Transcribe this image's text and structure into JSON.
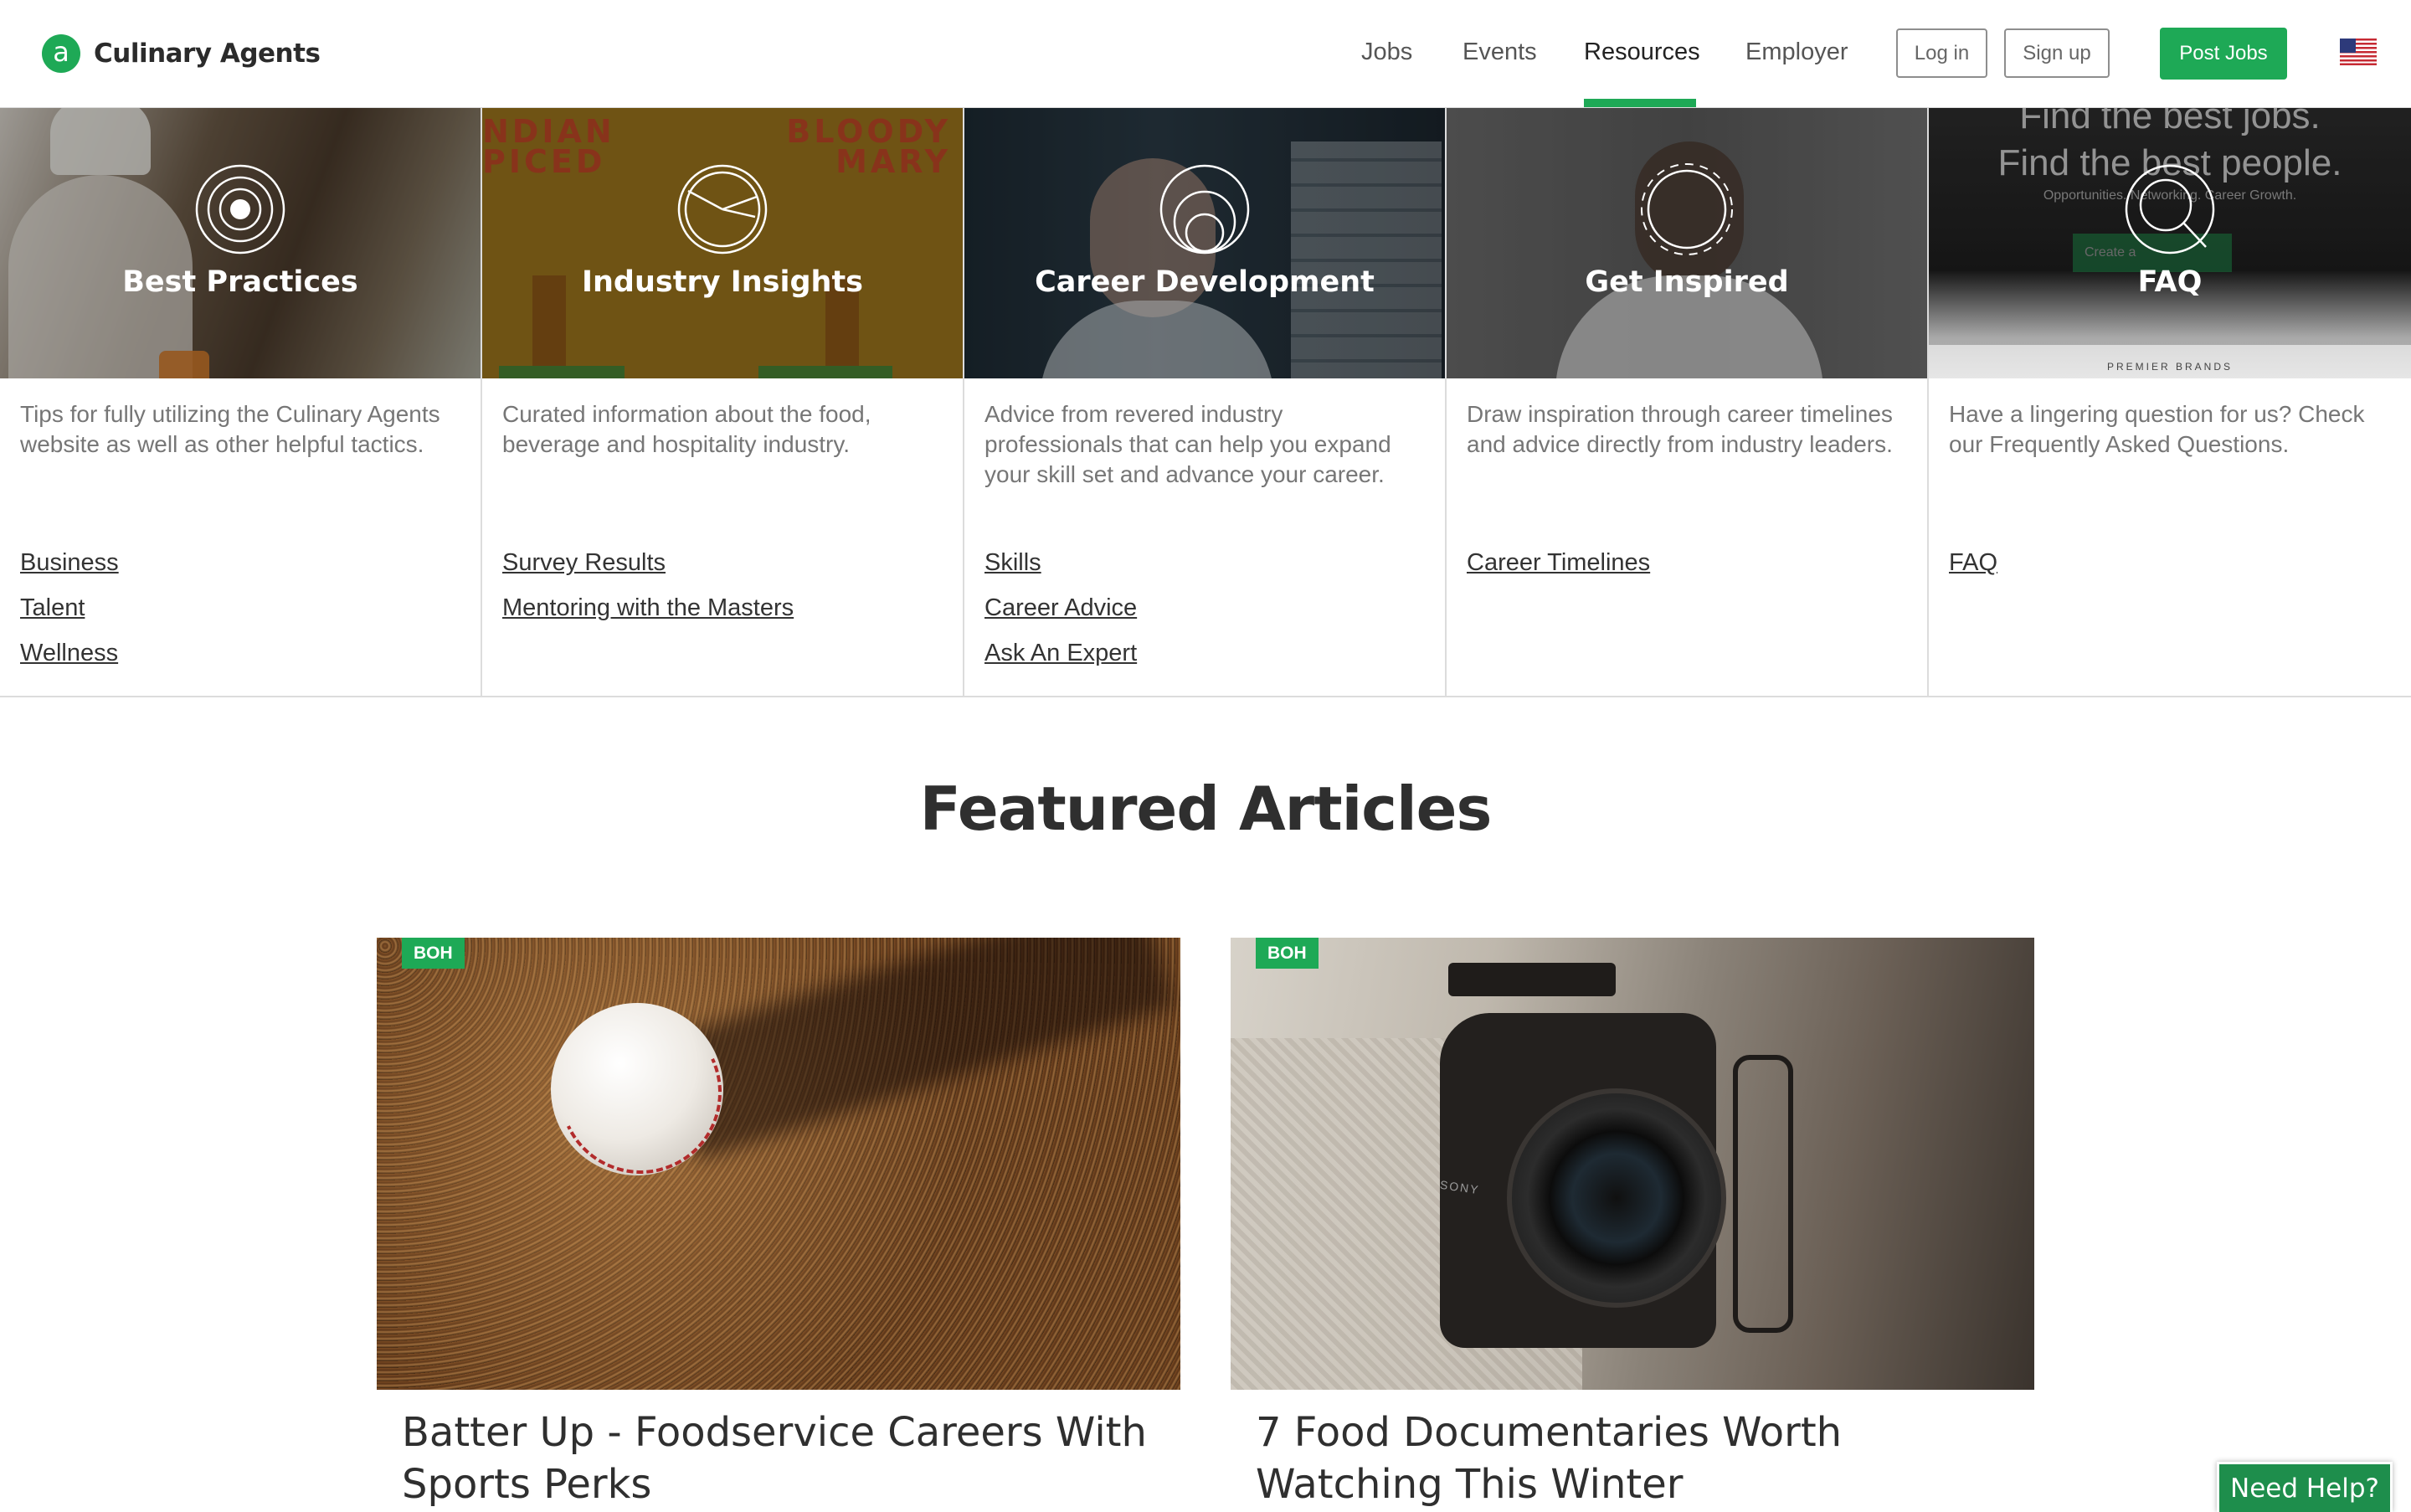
{
  "header": {
    "logo_letter": "a",
    "brand": "Culinary Agents",
    "nav": [
      {
        "label": "Jobs"
      },
      {
        "label": "Events"
      },
      {
        "label": "Resources",
        "active": true
      },
      {
        "label": "Employer"
      }
    ],
    "login_label": "Log in",
    "signup_label": "Sign up",
    "post_jobs_label": "Post Jobs",
    "flag_icon": "us-flag-icon"
  },
  "colors": {
    "accent": "#1ea956",
    "text_dark": "#2f2f2f",
    "text_muted": "#767676"
  },
  "categories": [
    {
      "title": "Best Practices",
      "icon": "target-icon",
      "description": "Tips for fully utilizing the Culinary Agents website as well as other helpful tactics.",
      "links": [
        "Business",
        "Talent",
        "Wellness"
      ]
    },
    {
      "title": "Industry Insights",
      "icon": "pie-chart-icon",
      "description": "Curated information about the food, beverage and hospitality industry.",
      "links": [
        "Survey Results",
        "Mentoring with the Masters"
      ],
      "banner_text": [
        "NDIAN",
        "PICED",
        "BLOODY",
        "MARY"
      ]
    },
    {
      "title": "Career Development",
      "icon": "growth-circles-icon",
      "description": "Advice from revered industry professionals that can help you expand your skill set and advance your career.",
      "links": [
        "Skills",
        "Career Advice",
        "Ask An Expert"
      ]
    },
    {
      "title": "Get Inspired",
      "icon": "spark-circle-icon",
      "description": "Draw inspiration through career timelines and advice directly from industry leaders.",
      "links": [
        "Career Timelines"
      ]
    },
    {
      "title": "FAQ",
      "icon": "magnifier-icon",
      "description": "Have a lingering question for us? Check our Frequently Asked Questions.",
      "links": [
        "FAQ"
      ],
      "banner_text": [
        "Find the best jobs.",
        "Find the best people.",
        "Opportunities. Networking. Career Growth.",
        "Create a",
        "PREMIER BRANDS"
      ]
    }
  ],
  "featured": {
    "title": "Featured Articles",
    "articles": [
      {
        "badge": "BOH",
        "title": "Batter Up - Foodservice Careers With Sports Perks",
        "image_icon": "baseball-image"
      },
      {
        "badge": "BOH",
        "title": "7 Food Documentaries Worth Watching This Winter",
        "image_icon": "camera-image",
        "camera_brand": "SONY"
      }
    ]
  },
  "help_label": "Need Help?"
}
